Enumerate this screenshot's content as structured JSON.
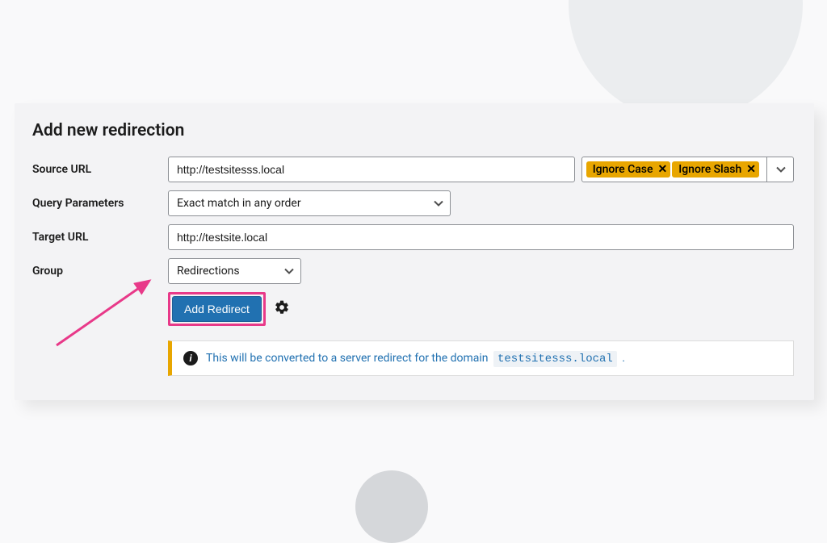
{
  "panel": {
    "title": "Add new redirection"
  },
  "labels": {
    "source": "Source URL",
    "query": "Query Parameters",
    "target": "Target URL",
    "group": "Group"
  },
  "source": {
    "value": "http://testsitesss.local",
    "tags": {
      "ignoreCase": "Ignore Case",
      "ignoreSlash": "Ignore Slash"
    }
  },
  "query": {
    "selected": "Exact match in any order"
  },
  "target": {
    "value": "http://testsite.local"
  },
  "group": {
    "selected": "Redirections"
  },
  "buttons": {
    "addRedirect": "Add Redirect"
  },
  "notice": {
    "text": "This will be converted to a server redirect for the domain ",
    "domain": "testsitesss.local",
    "after": " ."
  }
}
